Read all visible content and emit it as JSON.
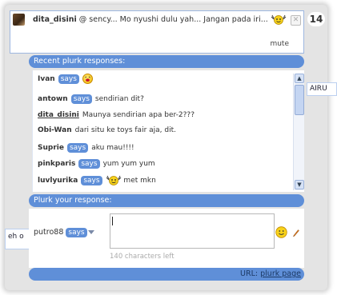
{
  "background": {
    "right_snippet": "AIRU",
    "left_snippet": "eh o"
  },
  "plurk": {
    "author": "dita_disini",
    "text": " @ sency... Mo nyushi dulu yah... Jangan pada iri...",
    "mute_label": "mute",
    "response_count": "14"
  },
  "responses_header": "Recent plurk responses:",
  "says_label": "says",
  "responses": [
    {
      "user": "Ivan",
      "says": true,
      "text": "",
      "emote": "laugh-emoticon"
    },
    {
      "user": "antown",
      "says": true,
      "text": "sendirian dit?"
    },
    {
      "user": "dita_disini",
      "says": false,
      "text": "Maunya sendirian apa ber-2???"
    },
    {
      "user": "Obi-Wan",
      "says": false,
      "text": "dari situ ke toys fair aja, dit."
    },
    {
      "user": "Suprie",
      "says": true,
      "text": "aku mau!!!!"
    },
    {
      "user": "pinkparis",
      "says": true,
      "text": "yum yum yum"
    },
    {
      "user": "luvlyurika",
      "says": true,
      "text": "met mkn",
      "emote": "dancing-emoticon"
    }
  ],
  "reply": {
    "header": "Plurk your response:",
    "username": "putro88",
    "says_label": "says",
    "input_value": "",
    "chars_left": "140 characters left"
  },
  "footer": {
    "url_label": "URL:",
    "link_text": "plurk page"
  },
  "colors": {
    "accent": "#5f8fd8",
    "border": "#9eb7e0"
  }
}
